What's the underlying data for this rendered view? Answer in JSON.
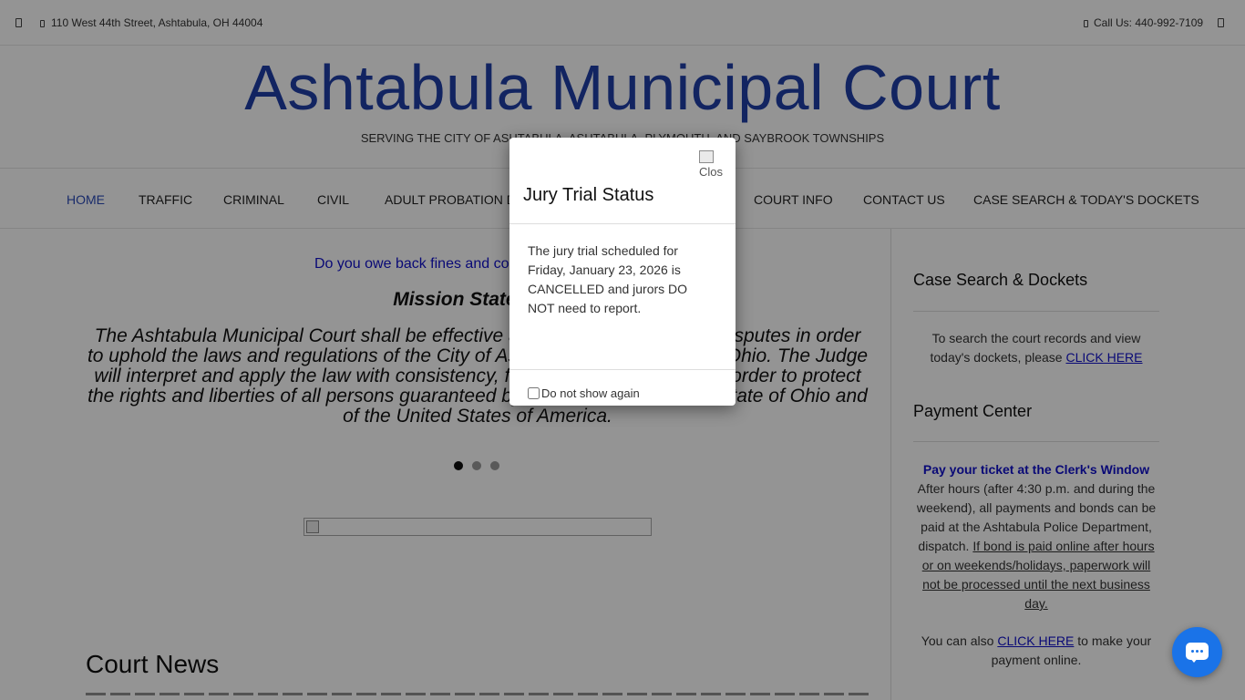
{
  "topbar": {
    "address": "110 West 44th Street, Ashtabula, OH 44004",
    "phone": "Call Us: 440-992-7109",
    "icons": [
      "facebook-icon",
      "map-marker-icon",
      "phone-icon",
      "menu-icon"
    ]
  },
  "header": {
    "title": "Ashtabula Municipal Court",
    "tagline": "SERVING THE CITY OF ASHTABULA, ASHTABULA, PLYMOUTH, AND SAYBROOK TOWNSHIPS"
  },
  "nav": {
    "items": [
      {
        "label": "HOME"
      },
      {
        "label": "TRAFFIC"
      },
      {
        "label": "CRIMINAL"
      },
      {
        "label": "CIVIL"
      },
      {
        "label": "ADULT PROBATION DEPARTMENT"
      },
      {
        "label": "COURT INFO"
      },
      {
        "label": "CONTACT US"
      },
      {
        "label": "CASE SEARCH & TODAY'S DOCKETS"
      }
    ]
  },
  "main": {
    "banner_link": "Do you owe back fines and co",
    "mission_title": "Mission Statement",
    "mission_text": "The Ashtabula Municipal Court shall be effective and efficient in resolving disputes in order to uphold the laws and regulations of the City of Ashtabula and the State of Ohio. The Judge will interpret and apply the law with consistency, fairness and impartiality in order to protect the rights and liberties of all persons guaranteed by the Constitution of the State of Ohio and of the United States of America.",
    "news_title": "Court News"
  },
  "sidebar": {
    "case_search": {
      "heading": "Case Search & Dockets",
      "text_before": "To search the court records and view today's dockets, please ",
      "link": "CLICK HERE"
    },
    "payment": {
      "heading": "Payment Center",
      "clerk_link": "Pay your ticket at the Clerk's Window",
      "text": "After hours (after 4:30 p.m. and during the weekend), all payments and bonds can be paid at the Ashtabula Police Department, dispatch. ",
      "underlined": "If bond is paid online after hours or on weekends/holidays, paperwork will not be processed until the next business day.",
      "also_before": "You can also ",
      "also_link": "CLICK HERE",
      "also_after": " to make your payment online."
    }
  },
  "modal": {
    "close_alt": "Close",
    "title": "Jury Trial Status",
    "body": "The jury trial scheduled for Friday, January 23, 2026 is CANCELLED and jurors DO NOT need to report.",
    "checkbox_label": "Do not show again",
    "checkbox_checked": false
  },
  "chat": {
    "icon": "chat-bubble-icon",
    "color": "#1a73e8"
  },
  "colors": {
    "title_blue": "#1f3fa8",
    "link_blue": "#1010cc",
    "overlay": "rgba(0,0,0,0.42)"
  }
}
